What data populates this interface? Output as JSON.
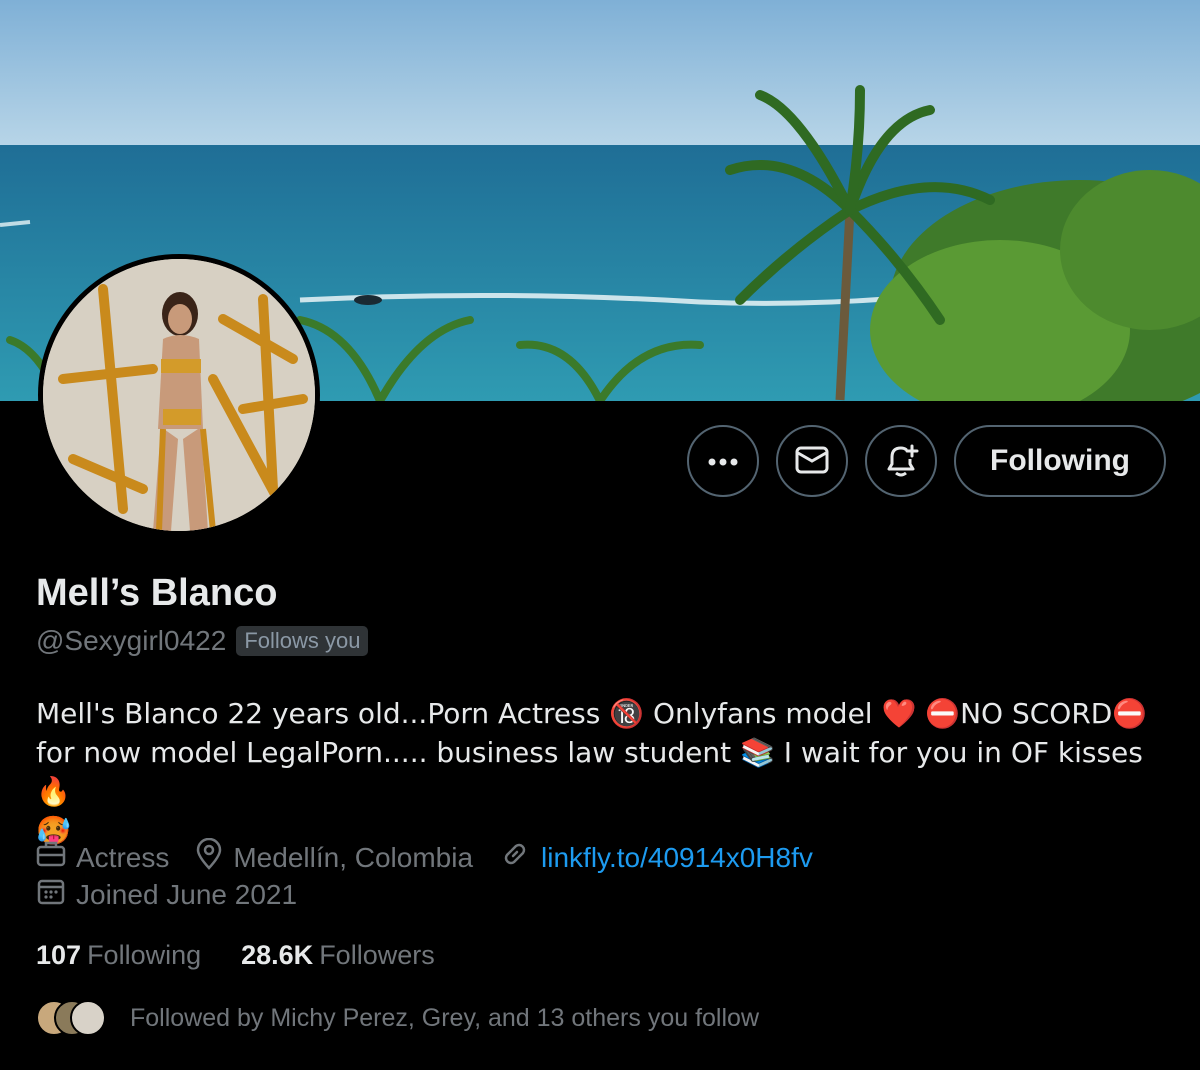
{
  "profile": {
    "display_name": "Mell’s Blanco",
    "handle": "@Sexygirl0422",
    "follows_you_badge": "Follows you",
    "bio_line1": "Mell's Blanco 22 years old...Porn Actress 🔞 Onlyfans model ❤️ ⛔NO SCORD⛔",
    "bio_line2": "for now model LegalPorn..... business law student 📚 I wait for you in OF kisses 🔥",
    "bio_line3": "🥵"
  },
  "actions": {
    "more_icon": "more-horizontal-icon",
    "message_icon": "envelope-icon",
    "notify_icon": "bell-plus-icon",
    "following_label": "Following"
  },
  "meta": {
    "profession": "Actress",
    "location": "Medellín, Colombia",
    "link": "linkfly.to/40914x0H8fv",
    "joined": "Joined June 2021"
  },
  "stats": {
    "following_count": "107",
    "following_label": "Following",
    "followers_count": "28.6K",
    "followers_label": "Followers"
  },
  "followed_by": {
    "text": "Followed by Michy Perez, Grey, and 13 others you follow"
  },
  "colors": {
    "background": "#000000",
    "text_primary": "#e7e9ea",
    "text_secondary": "#71767b",
    "link": "#1d9bf0",
    "border": "#536471"
  }
}
